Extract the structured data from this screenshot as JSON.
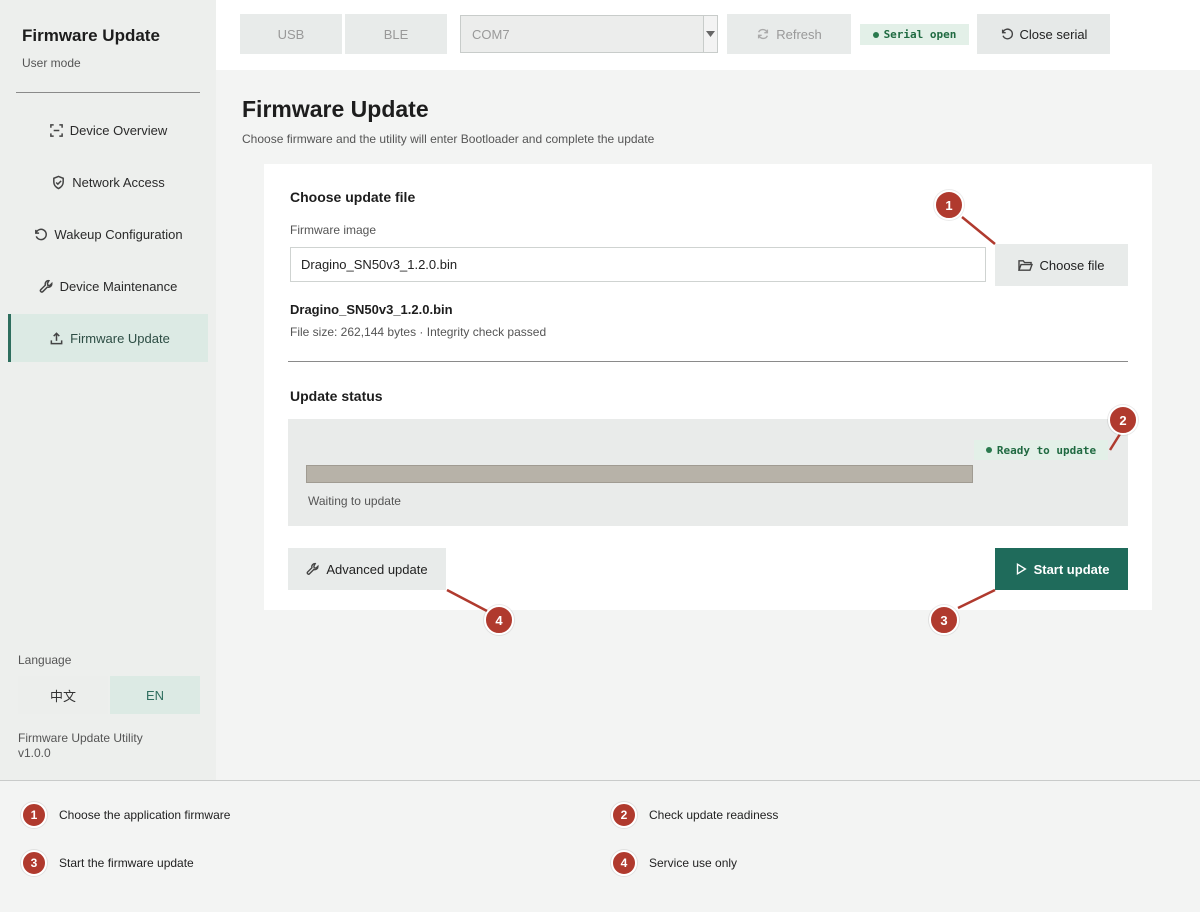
{
  "sidebar": {
    "app_title": "Firmware Update",
    "mode": "User mode",
    "items": [
      {
        "label": "Device Overview",
        "icon": "scan-icon",
        "active": false
      },
      {
        "label": "Network Access",
        "icon": "shield-icon",
        "active": false
      },
      {
        "label": "Wakeup Configuration",
        "icon": "reset-icon",
        "active": false
      },
      {
        "label": "Device Maintenance",
        "icon": "wrench-icon",
        "active": false
      },
      {
        "label": "Firmware Update",
        "icon": "upload-icon",
        "active": true
      }
    ],
    "language_label": "Language",
    "languages": [
      "中文",
      "EN"
    ],
    "active_language": "EN",
    "utility_name": "Firmware Update Utility",
    "version": "v1.0.0"
  },
  "topbar": {
    "usb_label": "USB",
    "ble_label": "BLE",
    "port_value": "COM7",
    "refresh_label": "Refresh",
    "serial_status": "Serial open",
    "close_label": "Close serial"
  },
  "main": {
    "title": "Firmware Update",
    "subtitle": "Choose firmware and the utility will enter Bootloader and complete the update",
    "choose_section": {
      "title": "Choose update file",
      "field_label": "Firmware image",
      "file_value": "Dragino_SN50v3_1.2.0.bin",
      "choose_label": "Choose file",
      "file_name": "Dragino_SN50v3_1.2.0.bin",
      "file_meta": "File size: 262,144 bytes · Integrity check passed"
    },
    "status_section": {
      "title": "Update status",
      "ready_badge": "Ready to update",
      "progress": 0,
      "status_text": "Waiting to update"
    },
    "advanced_label": "Advanced update",
    "start_label": "Start update"
  },
  "callouts": [
    {
      "n": "1",
      "text": "Choose the application firmware"
    },
    {
      "n": "2",
      "text": "Check update readiness"
    },
    {
      "n": "3",
      "text": "Start the firmware update"
    },
    {
      "n": "4",
      "text": "Service use only"
    }
  ],
  "colors": {
    "accent": "#1f6b5b",
    "marker": "#b03a2e",
    "badge_bg": "#e3f0e8",
    "badge_text": "#1f6a41"
  }
}
